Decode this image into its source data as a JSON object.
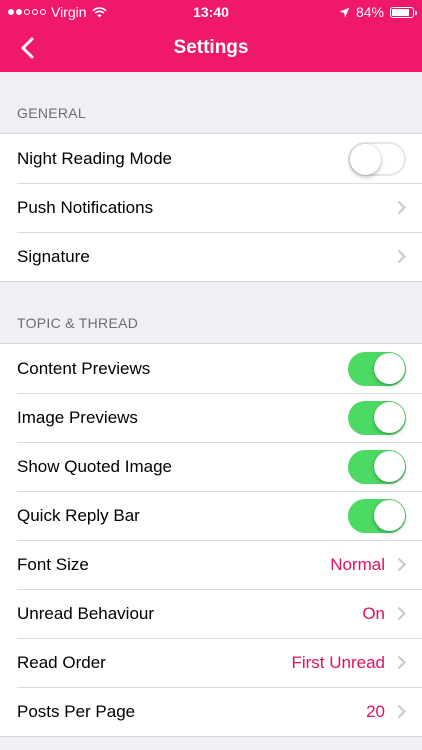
{
  "status_bar": {
    "carrier": "Virgin",
    "time": "13:40",
    "battery": "84%"
  },
  "nav": {
    "title": "Settings"
  },
  "colors": {
    "brand": "#f0186b",
    "accent_value": "#e01064",
    "toggle_on": "#4cd964"
  },
  "sections": [
    {
      "header": "GENERAL"
    },
    {
      "header": "TOPIC & THREAD"
    }
  ],
  "rows": {
    "night_reading": {
      "label": "Night Reading Mode",
      "on": false
    },
    "push_notifications": {
      "label": "Push Notifications"
    },
    "signature": {
      "label": "Signature"
    },
    "content_previews": {
      "label": "Content Previews",
      "on": true
    },
    "image_previews": {
      "label": "Image Previews",
      "on": true
    },
    "show_quoted_image": {
      "label": "Show Quoted Image",
      "on": true
    },
    "quick_reply_bar": {
      "label": "Quick Reply Bar",
      "on": true
    },
    "font_size": {
      "label": "Font Size",
      "value": "Normal"
    },
    "unread_behaviour": {
      "label": "Unread Behaviour",
      "value": "On"
    },
    "read_order": {
      "label": "Read Order",
      "value": "First Unread"
    },
    "posts_per_page": {
      "label": "Posts Per Page",
      "value": "20"
    }
  }
}
